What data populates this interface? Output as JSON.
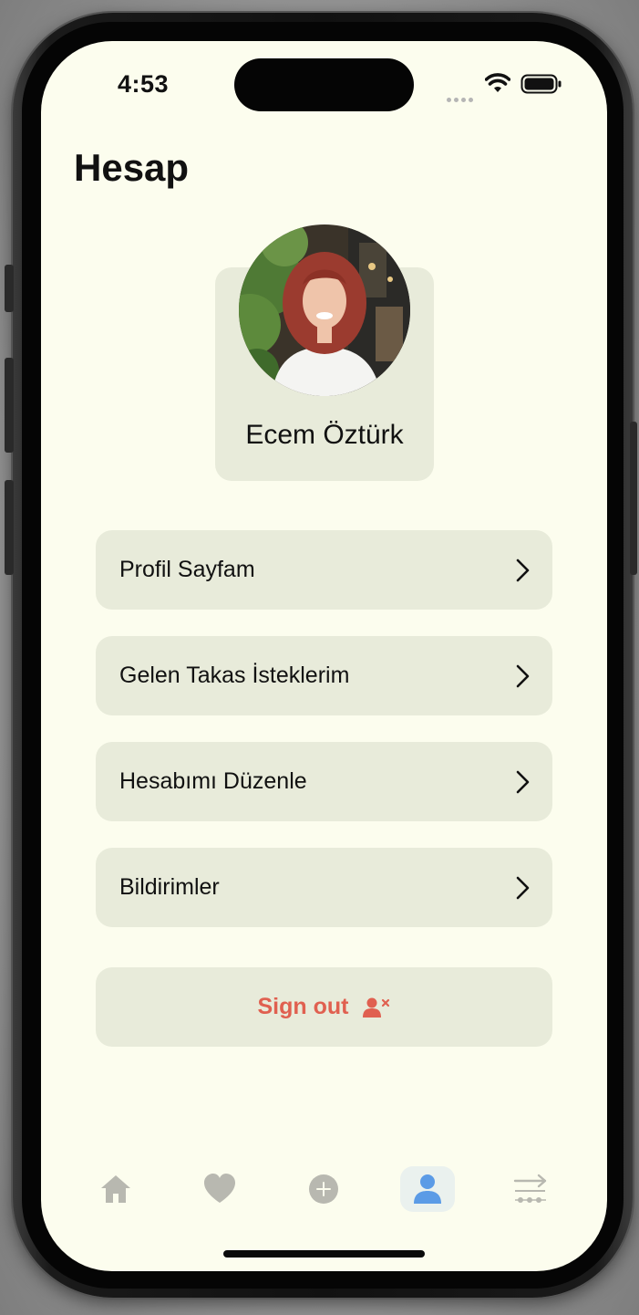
{
  "status_bar": {
    "time": "4:53",
    "signal_icon": "signal-dots-icon",
    "wifi_icon": "wifi-icon",
    "battery_icon": "battery-icon"
  },
  "page": {
    "title": "Hesap"
  },
  "profile": {
    "name": "Ecem Öztürk",
    "avatar_icon": "avatar-photo"
  },
  "menu": {
    "items": [
      {
        "label": "Profil Sayfam",
        "icon": "chevron-right-icon"
      },
      {
        "label": "Gelen Takas İsteklerim",
        "icon": "chevron-right-icon"
      },
      {
        "label": "Hesabımı Düzenle",
        "icon": "chevron-right-icon"
      },
      {
        "label": "Bildirimler",
        "icon": "chevron-right-icon"
      }
    ]
  },
  "signout": {
    "label": "Sign out",
    "icon": "user-remove-icon",
    "color": "#e06050"
  },
  "tab_bar": {
    "items": [
      {
        "icon": "home-icon",
        "active": false
      },
      {
        "icon": "heart-icon",
        "active": false
      },
      {
        "icon": "add-circle-icon",
        "active": false
      },
      {
        "icon": "person-icon",
        "active": true
      },
      {
        "icon": "swap-icon",
        "active": false
      }
    ],
    "active_color": "#5b9be6",
    "inactive_color": "#b8b8b0"
  },
  "colors": {
    "screen_background": "#fcfdee",
    "card_background": "#e8ebda"
  }
}
